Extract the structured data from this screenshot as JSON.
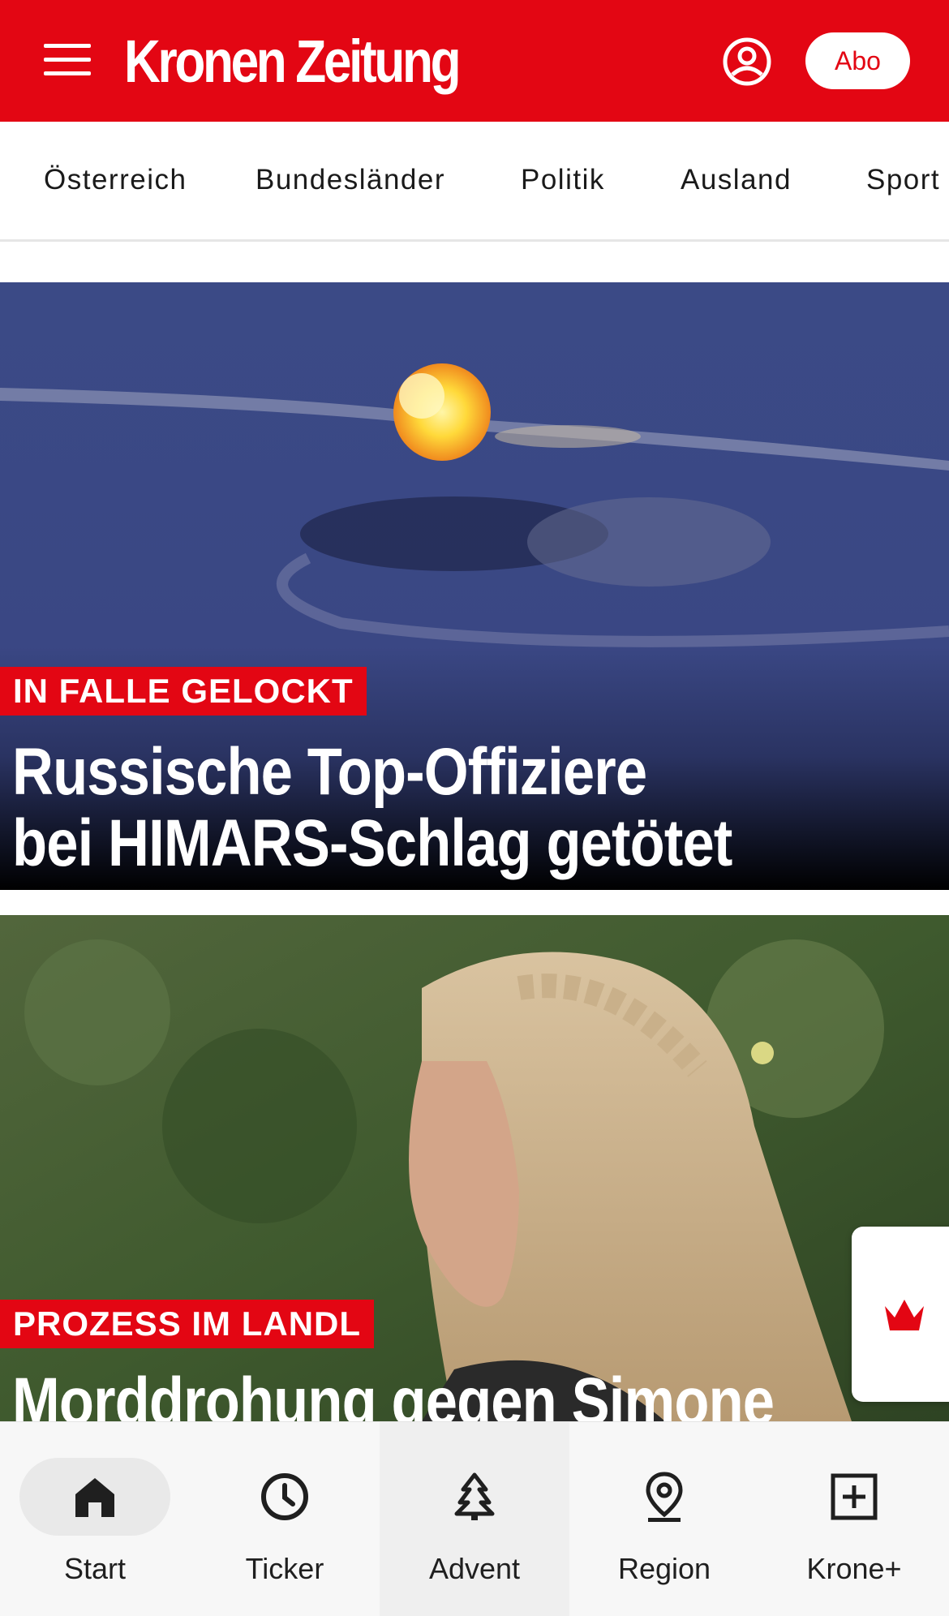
{
  "colors": {
    "brand_red": "#e30613",
    "nav_bg": "#f7f7f7",
    "text_dark": "#1a1a1a"
  },
  "header": {
    "logo_text": "Kronen Zeitung",
    "abo_label": "Abo",
    "icons": [
      "menu-icon",
      "account-icon"
    ]
  },
  "categories": [
    {
      "label": "Österreich"
    },
    {
      "label": "Bundesländer"
    },
    {
      "label": "Politik"
    },
    {
      "label": "Ausland"
    },
    {
      "label": "Sport"
    }
  ],
  "articles": [
    {
      "kicker": "IN FALLE GELOCKT",
      "headline_line1": "Russische Top-Offiziere",
      "headline_line2": "bei HIMARS-Schlag getötet"
    },
    {
      "kicker": "PROZESS IM LANDL",
      "headline_line1": "Morddrohung gegen Simone"
    }
  ],
  "floating_widget": {
    "icon": "crown-icon"
  },
  "bottom_nav": [
    {
      "label": "Start",
      "icon": "home-icon",
      "active": true
    },
    {
      "label": "Ticker",
      "icon": "clock-icon"
    },
    {
      "label": "Advent",
      "icon": "tree-icon"
    },
    {
      "label": "Region",
      "icon": "location-pin-icon"
    },
    {
      "label": "Krone+",
      "icon": "plus-box-icon"
    }
  ]
}
